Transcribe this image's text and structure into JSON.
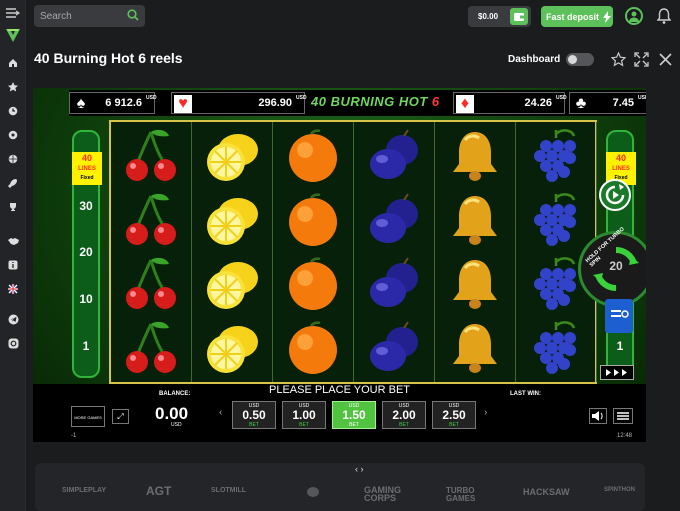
{
  "sidebar": {
    "items": [
      "menu-icon",
      "home-icon",
      "star-icon",
      "clock-icon",
      "soccer-icon",
      "ball-icon",
      "rocket-icon",
      "trophy-icon",
      "handshake-icon",
      "info-icon",
      "flag-uk-icon",
      "telegram-icon",
      "instagram-icon"
    ]
  },
  "topbar": {
    "search_placeholder": "Search",
    "balance": "$0.00",
    "deposit_label": "Fast deposit"
  },
  "header": {
    "title": "40 Burning Hot 6 reels",
    "dashboard_label": "Dashboard"
  },
  "game": {
    "logo_text": "40 BURNING HOT",
    "logo_num": "6",
    "jackpots": [
      {
        "suit": "♠",
        "value": "6 912.6",
        "currency": "USD",
        "color": "#ffffff"
      },
      {
        "suit": "♥",
        "value": "296.90",
        "currency": "USD",
        "color": "#ff2b2b"
      },
      {
        "suit": "♦",
        "value": "24.26",
        "currency": "USD",
        "color": "#ff2b2b"
      },
      {
        "suit": "♣",
        "value": "7.45",
        "currency": "USD",
        "color": "#ffffff"
      }
    ],
    "lines_label": "40",
    "lines_sub": "LINES",
    "lines_fixed": "Fixed",
    "line_numbers": [
      "30",
      "20",
      "10",
      "1"
    ],
    "turbo_text": "HOLD FOR TURBO SPIN",
    "turbo_num": "20",
    "reels": [
      [
        "cherries",
        "cherries",
        "cherries",
        "cherries"
      ],
      [
        "lemon",
        "lemon",
        "lemon",
        "lemon"
      ],
      [
        "orange",
        "orange",
        "orange",
        "orange"
      ],
      [
        "plum",
        "plum",
        "plum",
        "plum"
      ],
      [
        "bell",
        "bell",
        "bell",
        "bell"
      ],
      [
        "grapes",
        "grapes",
        "grapes",
        "grapes"
      ]
    ],
    "controls": {
      "message": "PLEASE PLACE YOUR BET",
      "balance_label": "BALANCE:",
      "balance_value": "0.00",
      "balance_currency": "USD",
      "last_win_label": "LAST WIN:",
      "more_games": "MORE GAMES",
      "bets": [
        {
          "currency": "USD",
          "value": "0.50",
          "label": "BET",
          "active": false
        },
        {
          "currency": "USD",
          "value": "1.00",
          "label": "BET",
          "active": false
        },
        {
          "currency": "USD",
          "value": "1.50",
          "label": "BET",
          "active": true
        },
        {
          "currency": "USD",
          "value": "2.00",
          "label": "BET",
          "active": false
        },
        {
          "currency": "USD",
          "value": "2.50",
          "label": "BET",
          "active": false
        }
      ]
    },
    "status_left": "-1",
    "clock": "12:48"
  },
  "providers": {
    "nav": "‹ ›",
    "items": [
      "SIMPLEPLAY",
      "AGT",
      "SLOTMILL",
      "",
      "GAMING CORPS",
      "TURBO GAMES",
      "HACKSAW",
      "SPINTHON"
    ]
  }
}
